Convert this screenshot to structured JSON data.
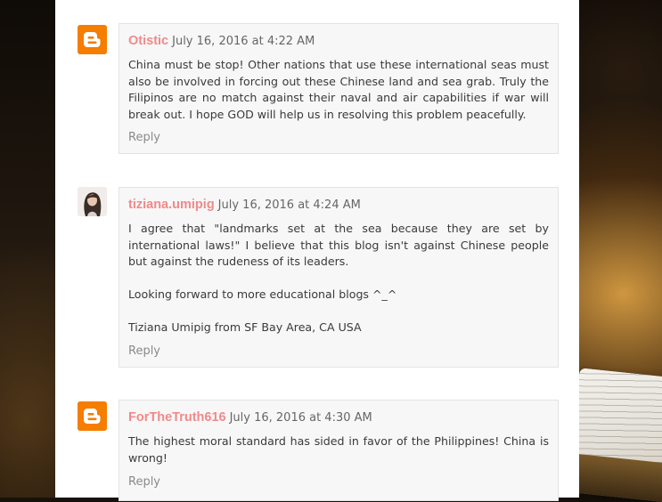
{
  "comments": [
    {
      "author": "Otistic",
      "date": "July 16, 2016 at 4:22 AM",
      "avatar_icon": "blogger-icon",
      "paragraphs": [
        "China must be stop! Other nations that use these international seas must also be involved in forcing out these Chinese land and sea grab. Truly the Filipinos are no match against their naval and air capabilities if war will break out. I hope GOD will help us in resolving this problem peacefully."
      ],
      "reply_label": "Reply"
    },
    {
      "author": "tiziana.umipig",
      "date": "July 16, 2016 at 4:24 AM",
      "avatar_icon": "user-photo",
      "paragraphs": [
        "I agree that \"landmarks set at the sea because they are set by international laws!\" I believe that this blog isn't against Chinese people but against the rudeness of its leaders.",
        "Looking forward to more educational blogs ^_^",
        "Tiziana Umipig from SF Bay Area, CA USA"
      ],
      "reply_label": "Reply"
    },
    {
      "author": "ForTheTruth616",
      "date": "July 16, 2016 at 4:30 AM",
      "avatar_icon": "blogger-icon",
      "paragraphs": [
        "The highest moral standard has sided in favor of the Philippines! China is wrong!"
      ],
      "reply_label": "Reply"
    }
  ],
  "colors": {
    "author": "#f08a8a",
    "blogger_orange": "#f57d00",
    "card_bg": "#f7f7f7",
    "reply": "#8a8a8a"
  }
}
